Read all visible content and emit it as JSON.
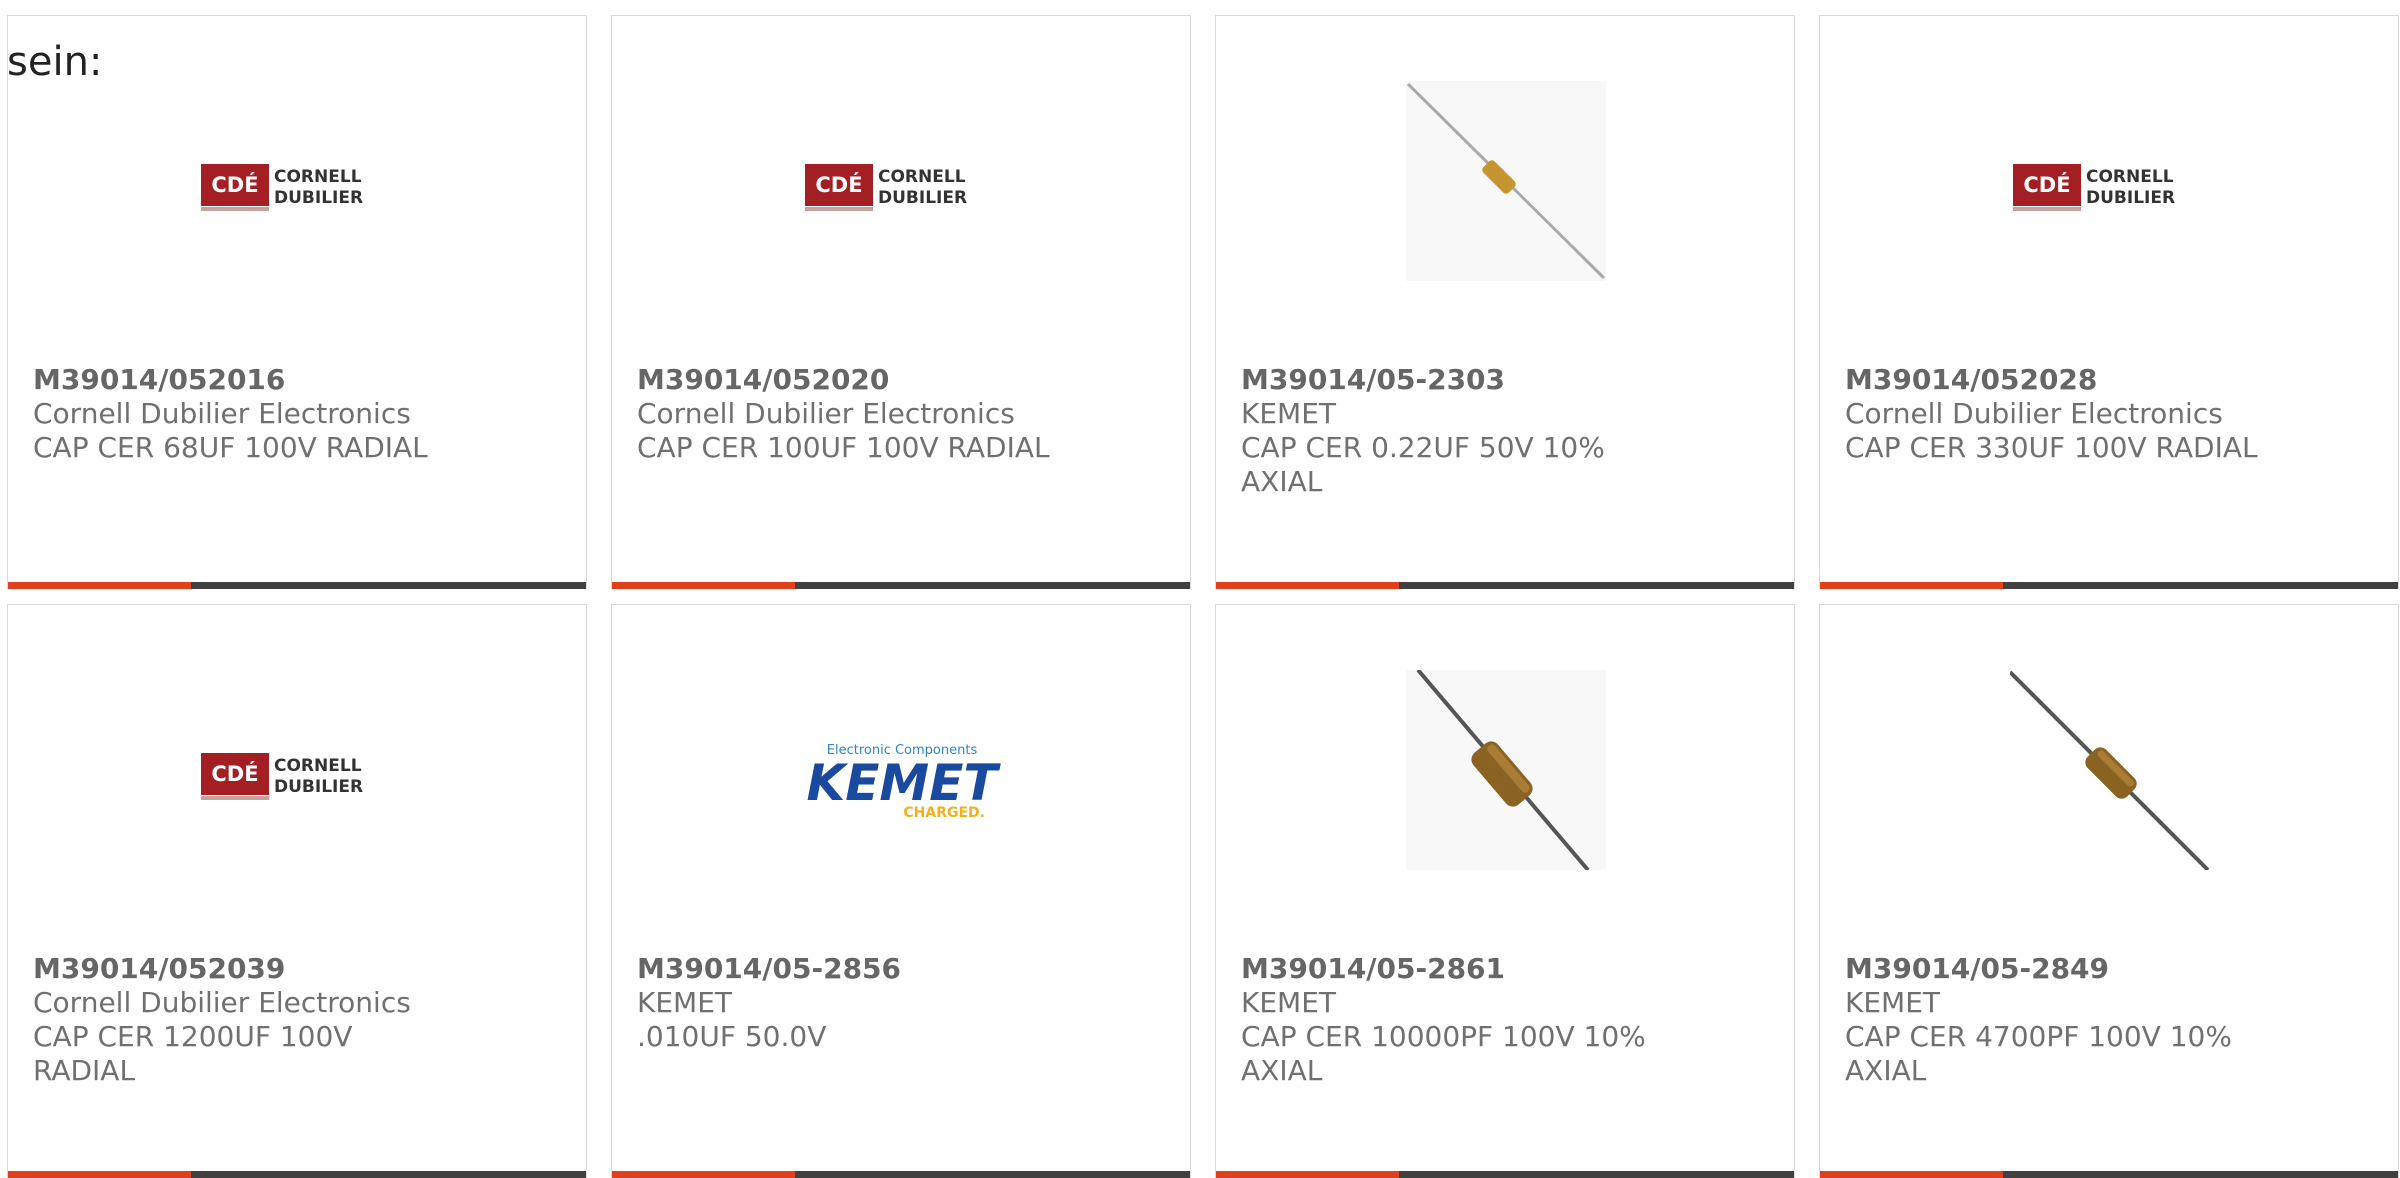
{
  "intro": "sein:",
  "colors": {
    "accent_bar": "#e2401c",
    "bar": "#414141",
    "text": "#707070"
  },
  "products": [
    {
      "part": "M39014/052016",
      "manufacturer": "Cornell Dubilier Electronics",
      "description": "CAP CER 68UF 100V RADIAL",
      "image": "cde-logo",
      "logo_text": [
        "CDÉ",
        "CORNELL",
        "DUBILIER"
      ]
    },
    {
      "part": "M39014/052020",
      "manufacturer": "Cornell Dubilier Electronics",
      "description": "CAP CER 100UF 100V RADIAL",
      "image": "cde-logo",
      "logo_text": [
        "CDÉ",
        "CORNELL",
        "DUBILIER"
      ]
    },
    {
      "part": "M39014/05-2303",
      "manufacturer": "KEMET",
      "description": "CAP CER 0.22UF 50V 10% AXIAL",
      "image": "axial-capacitor-photo"
    },
    {
      "part": "M39014/052028",
      "manufacturer": "Cornell Dubilier Electronics",
      "description": "CAP CER 330UF 100V RADIAL",
      "image": "cde-logo",
      "logo_text": [
        "CDÉ",
        "CORNELL",
        "DUBILIER"
      ]
    },
    {
      "part": "M39014/052039",
      "manufacturer": "Cornell Dubilier Electronics",
      "description": "CAP CER 1200UF 100V RADIAL",
      "image": "cde-logo",
      "logo_text": [
        "CDÉ",
        "CORNELL",
        "DUBILIER"
      ]
    },
    {
      "part": "M39014/05-2856",
      "manufacturer": "KEMET",
      "description": ".010UF 50.0V",
      "image": "kemet-logo",
      "logo_text": [
        "Electronic Components",
        "KEMET",
        "CHARGED."
      ]
    },
    {
      "part": "M39014/05-2861",
      "manufacturer": "KEMET",
      "description": "CAP CER 10000PF 100V 10% AXIAL",
      "image": "axial-capacitor-photo"
    },
    {
      "part": "M39014/05-2849",
      "manufacturer": "KEMET",
      "description": "CAP CER 4700PF 100V 10% AXIAL",
      "image": "axial-capacitor-photo"
    }
  ]
}
